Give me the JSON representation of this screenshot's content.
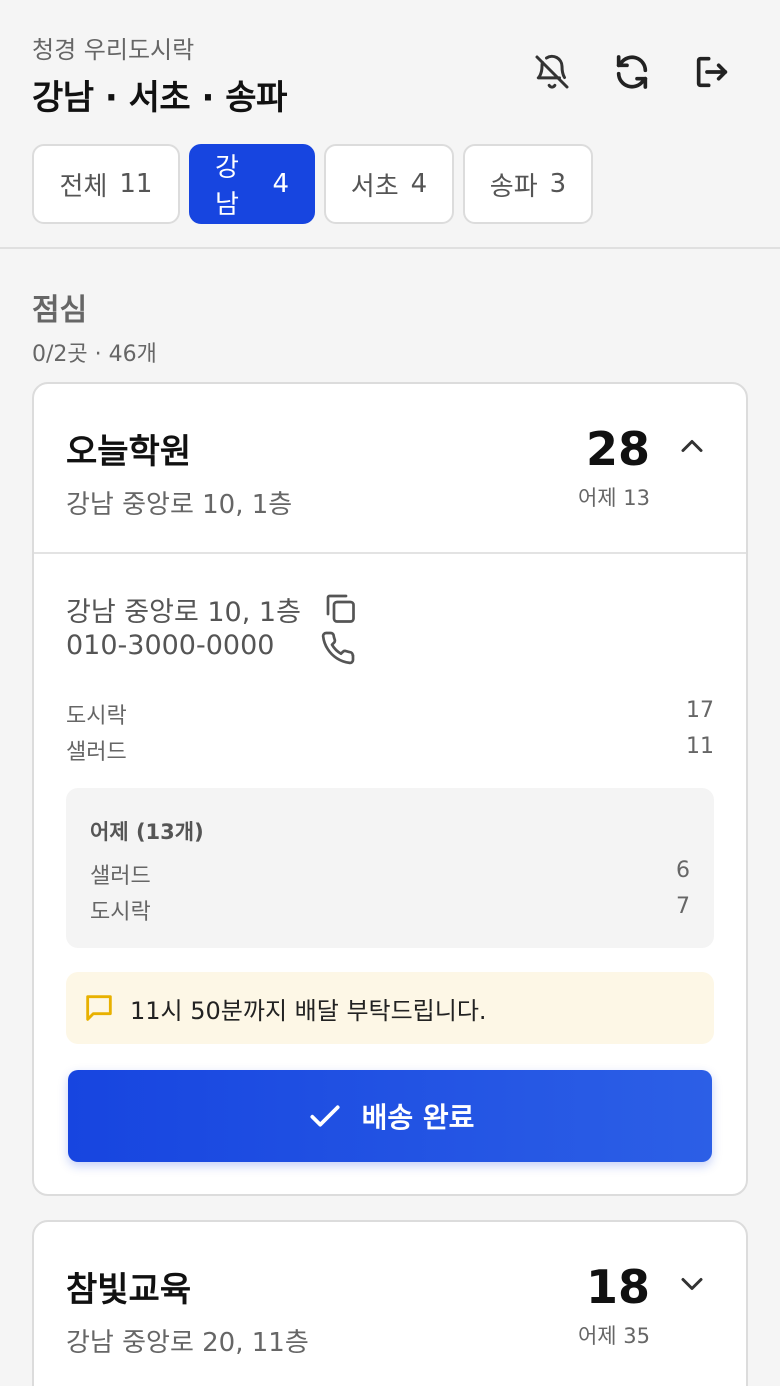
{
  "header": {
    "subtitle": "청경 우리도시락",
    "title": "강남 · 서초 · 송파"
  },
  "icons": {
    "notifications_off": "bell-off-icon",
    "refresh": "refresh-icon",
    "logout": "logout-icon"
  },
  "tabs": [
    {
      "label": "전체",
      "count": "11",
      "active": false
    },
    {
      "label": "강남",
      "count": "4",
      "active": true
    },
    {
      "label": "서초",
      "count": "4",
      "active": false
    },
    {
      "label": "송파",
      "count": "3",
      "active": false
    }
  ],
  "section": {
    "title": "점심",
    "summary": "0/2곳 · 46개"
  },
  "cards": [
    {
      "name": "오늘학원",
      "address": "강남 중앙로 10, 1층",
      "count": "28",
      "yesterday_label": "어제 13",
      "expanded": true,
      "contact_address": "강남 중앙로 10, 1층",
      "phone": "010-3000-0000",
      "items": [
        {
          "name": "도시락",
          "qty": "17"
        },
        {
          "name": "샐러드",
          "qty": "11"
        }
      ],
      "yesterday_box": {
        "title": "어제 (13개)",
        "items": [
          {
            "name": "샐러드",
            "qty": "6"
          },
          {
            "name": "도시락",
            "qty": "7"
          }
        ]
      },
      "note": "11시 50분까지 배달 부탁드립니다.",
      "done_button": "배송 완료"
    },
    {
      "name": "참빛교육",
      "address": "강남 중앙로 20, 11층",
      "count": "18",
      "yesterday_label": "어제 35",
      "expanded": false
    }
  ],
  "colors": {
    "accent": "#1745e0",
    "note_bg": "#fdf7e6",
    "note_icon": "#e8b100"
  }
}
